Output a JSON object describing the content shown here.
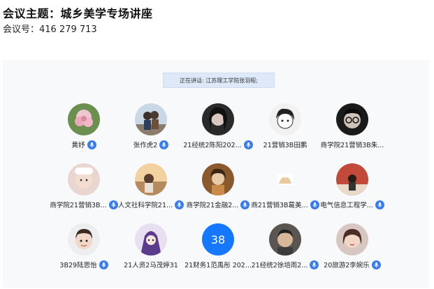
{
  "meeting": {
    "title": "会议主题：城乡美学专场讲座",
    "id_label": "会议号：416 279 713"
  },
  "speaking": {
    "text": "正在讲话: 江苏理工学院张羽程;"
  },
  "participants": [
    {
      "name": "黄妤",
      "avatar_style": "flower",
      "mic": "mic-icon"
    },
    {
      "name": "张作虎2",
      "avatar_style": "couple",
      "mic": "mic-icon"
    },
    {
      "name": "21经统2陈阳202...",
      "avatar_style": "dark-hair",
      "mic": "mic-icon"
    },
    {
      "name": "21营销3B田鹏",
      "avatar_style": "anime",
      "mic": ""
    },
    {
      "name": "商学院21营销3B朱...",
      "avatar_style": "glasses",
      "mic": ""
    },
    {
      "name": "商学院21营销3B...",
      "avatar_style": "baby",
      "mic": "mic-icon"
    },
    {
      "name": "人文社科学院21...",
      "avatar_style": "sunset",
      "mic": "mic-icon"
    },
    {
      "name": "商学院21金融2...",
      "avatar_style": "warm",
      "mic": "mic-icon"
    },
    {
      "name": "商21营销3B葛美...",
      "avatar_style": "small-pic",
      "mic": "mic-icon"
    },
    {
      "name": "电气信息工程学...",
      "avatar_style": "redwall",
      "mic": "mic-icon"
    },
    {
      "name": "3B29陆思怡",
      "avatar_style": "child",
      "mic": "mic-icon"
    },
    {
      "name": "21人资2马茂婷31",
      "avatar_style": "purple",
      "mic": ""
    },
    {
      "name": "21财务1范禹彤 202...",
      "avatar_style": "number",
      "avatar_text": "38",
      "mic": ""
    },
    {
      "name": "21经统2徐培雨2...",
      "avatar_style": "man",
      "mic": "mic-icon"
    },
    {
      "name": "20旅游2李婉乐",
      "avatar_style": "girl",
      "mic": "mic-icon"
    }
  ],
  "colors": {
    "accent": "#1677ff",
    "mic": "#3b7de8",
    "banner": "#dde8f8"
  }
}
